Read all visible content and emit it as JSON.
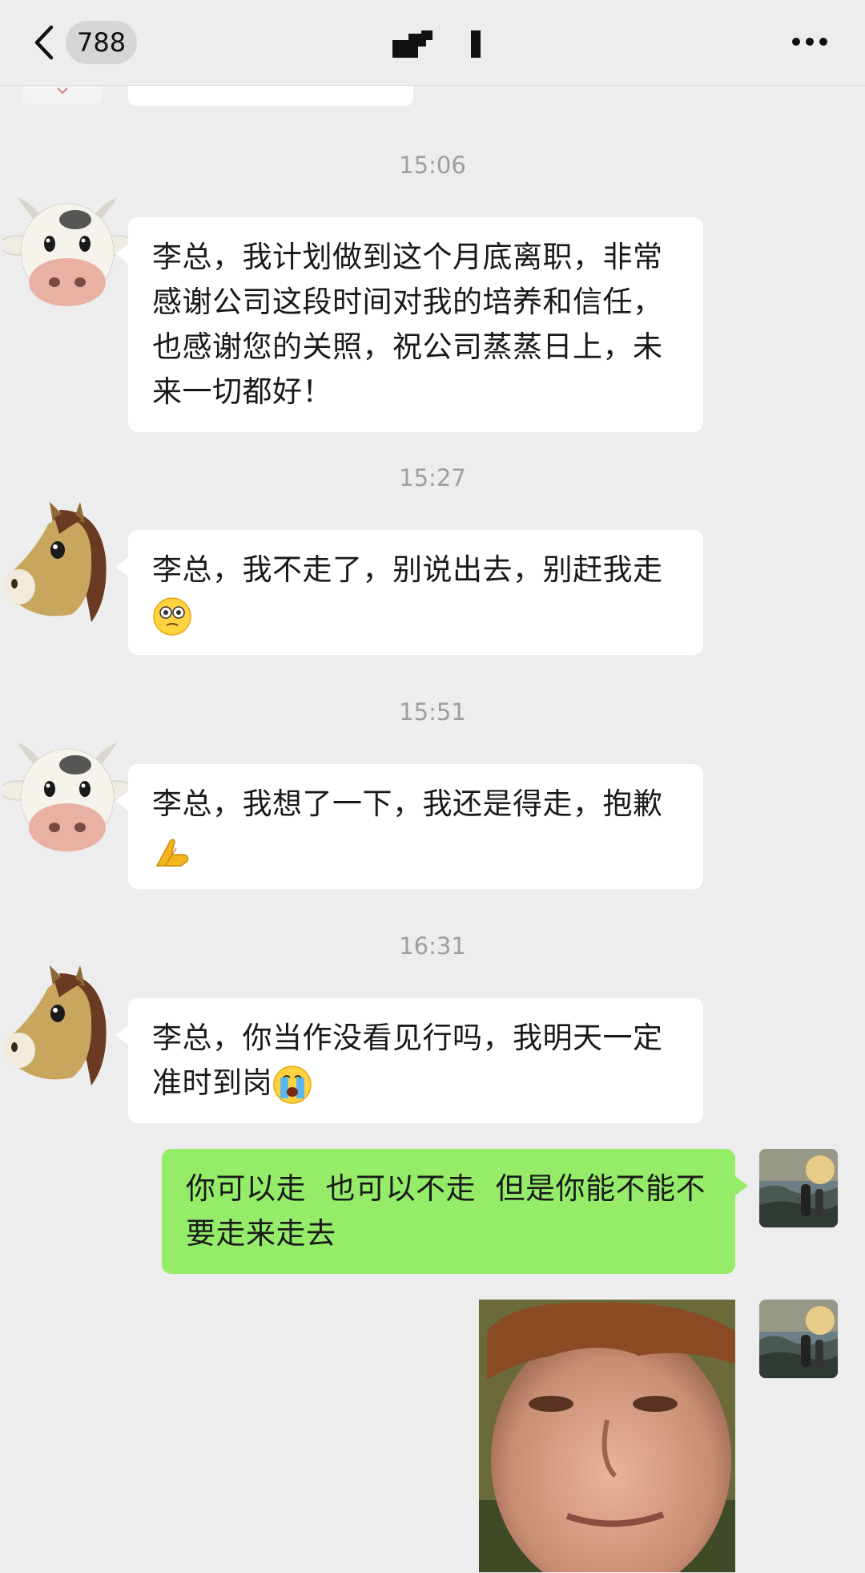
{
  "header": {
    "unread_count": "788"
  },
  "messages": [
    {
      "time": "15:06",
      "sender": "cow",
      "text": "李总，我计划做到这个月底离职，非常感谢公司这段时间对我的培养和信任，也感谢您的关照，祝公司蒸蒸日上，未来一切都好！",
      "emoji": ""
    },
    {
      "time": "15:27",
      "sender": "horse",
      "text": "李总，我不走了，别说出去，别赶我走",
      "emoji": "grimace-emoji"
    },
    {
      "time": "15:51",
      "sender": "cow",
      "text": "李总，我想了一下，我还是得走，抱歉",
      "emoji": "pray-emoji"
    },
    {
      "time": "16:31",
      "sender": "horse",
      "text": "李总，你当作没看见行吗，我明天一定准时到岗",
      "emoji": "crying-emoji"
    },
    {
      "time": "",
      "sender": "self",
      "text": "你可以走  也可以不走  但是你能不能不要走来走去",
      "emoji": ""
    },
    {
      "time": "",
      "sender": "self",
      "text": "",
      "image": "boy-face-sticker"
    }
  ],
  "colors": {
    "background": "#ededed",
    "self_bubble": "#95ec69",
    "other_bubble": "#ffffff",
    "timestamp": "#9e9e9e"
  }
}
